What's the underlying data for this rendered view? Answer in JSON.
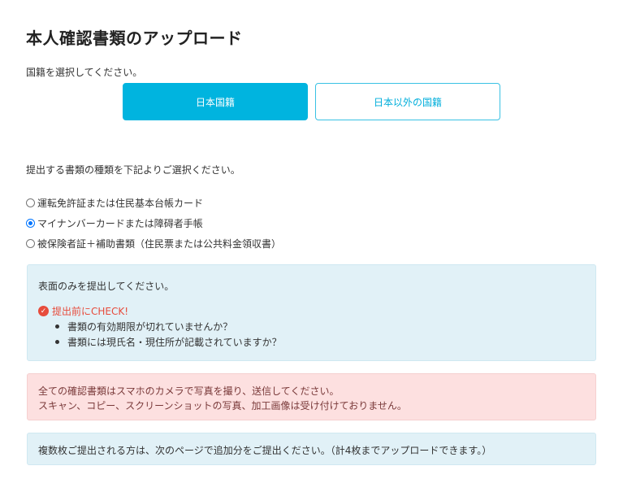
{
  "page": {
    "title": "本人確認書類のアップロード"
  },
  "nationality": {
    "prompt": "国籍を選択してください。",
    "options": [
      "日本国籍",
      "日本以外の国籍"
    ],
    "selected": "日本国籍"
  },
  "document_type": {
    "prompt": "提出する書類の種類を下記よりご選択ください。",
    "options": [
      {
        "label": "運転免許証または住民基本台帳カード",
        "checked": false
      },
      {
        "label": "マイナンバーカードまたは障碍者手帳",
        "checked": true
      },
      {
        "label": "被保険者証＋補助書類（住民票または公共料金領収書）",
        "checked": false
      }
    ]
  },
  "info_box": {
    "title": "表面のみを提出してください。",
    "check_heading": "提出前にCHECK!",
    "check_items": [
      "書類の有効期限が切れていませんか？",
      "書類には現氏名・現住所が記載されていますか？"
    ]
  },
  "warning_box": {
    "line1": "全ての確認書類はスマホのカメラで写真を撮り、送信してください。",
    "line2": "スキャン、コピー、スクリーンショットの写真、加工画像は受け付けておりません。"
  },
  "note_box": {
    "text": "複数枚ご提出される方は、次のページで追加分をご提出ください。（計4枚までアップロードできます。）"
  },
  "colors": {
    "accent": "#00b4df",
    "info_bg": "#e1f1f7",
    "warning_bg": "#fde0e0",
    "check_red": "#e74c3c"
  }
}
